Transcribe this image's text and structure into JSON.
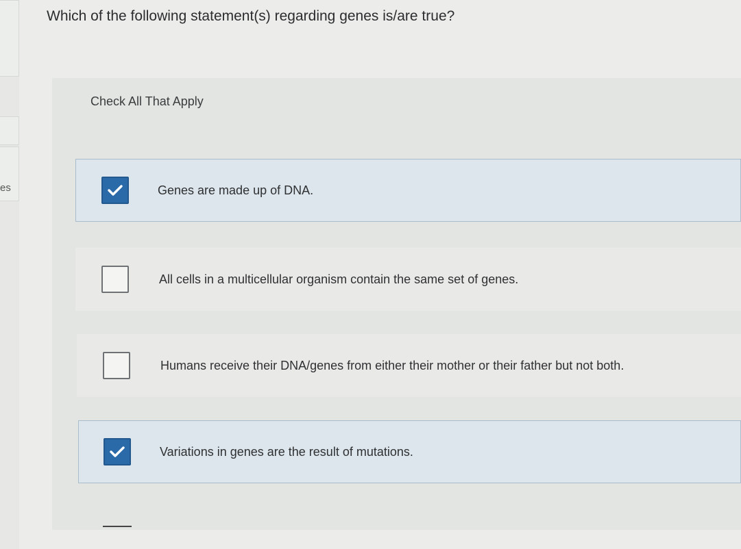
{
  "sidebar": {
    "tab_label": "es"
  },
  "question": {
    "text": "Which of the following statement(s) regarding genes is/are true?",
    "instruction": "Check All That Apply"
  },
  "options": [
    {
      "text": "Genes are made up of DNA.",
      "checked": true
    },
    {
      "text": "All cells in a multicellular organism contain the same set of genes.",
      "checked": false
    },
    {
      "text": "Humans receive their DNA/genes from either their mother or their father but not both.",
      "checked": false
    },
    {
      "text": "Variations in genes are the result of mutations.",
      "checked": true
    }
  ],
  "colors": {
    "checkbox_checked": "#2b6aa8",
    "checked_row_background": "#dde6ec"
  },
  "icons": {
    "checked": "checkmark-icon"
  }
}
